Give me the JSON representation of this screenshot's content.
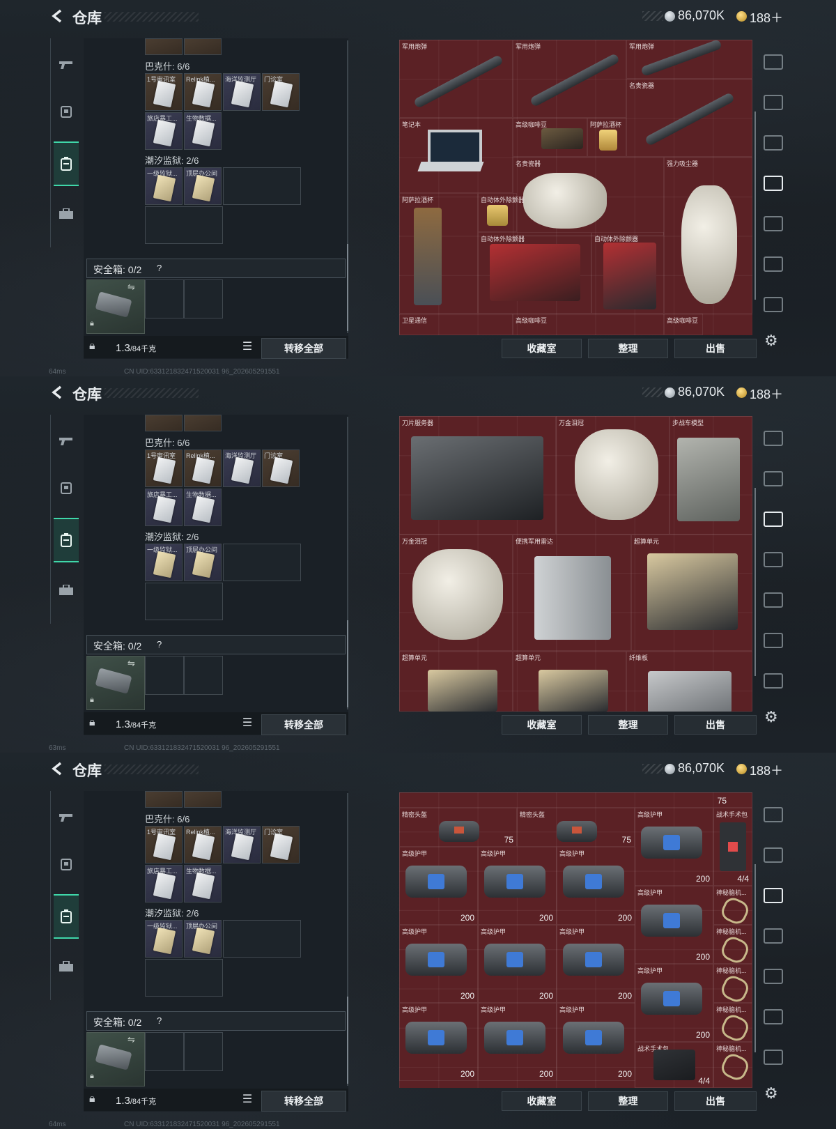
{
  "header": {
    "title": "仓库",
    "money": "86,070K",
    "gold": "188＋"
  },
  "sidebar_left": {
    "tabs": [
      "gun-icon",
      "armor-icon",
      "backpack-icon",
      "toolbox-icon"
    ],
    "active_index": 2
  },
  "inventory": {
    "section1_label": "巴克什: 6/6",
    "section1_items": [
      "1号审讯室",
      "Relink植...",
      "海洋监测厅",
      "门诊室",
      "旅店暴工...",
      "生物数据..."
    ],
    "section2_label": "潮汐监狱: 2/6",
    "section2_items": [
      "一级监狱...",
      "顶层办公间"
    ],
    "safe_label": "安全箱: 0/2",
    "safe_help": "?",
    "weight": "1.3",
    "weight_unit": "/84千克",
    "transfer_all": "转移全部"
  },
  "bottom_buttons": {
    "collection": "收藏室",
    "sort": "整理",
    "sell": "出售"
  },
  "status": {
    "ping1": "64ms",
    "ping2": "63ms",
    "ping3": "64ms",
    "uid": "CN UID:633121832471520031 96_202605291551"
  },
  "panels": [
    {
      "items": [
        {
          "name": "军用炮弹"
        },
        {
          "name": "军用炮弹"
        },
        {
          "name": "军用炮弹"
        },
        {
          "name": "笔记本"
        },
        {
          "name": "高级咖啡豆"
        },
        {
          "name": "阿萨拉酒杯"
        },
        {
          "name": "名贵瓷器"
        },
        {
          "name": "名贵瓷器"
        },
        {
          "name": "强力吸尘器"
        },
        {
          "name": "阿萨拉酒杯"
        },
        {
          "name": "自动体外除颤器"
        },
        {
          "name": "自动体外除颤器"
        },
        {
          "name": "自动体外除颤器"
        },
        {
          "name": "卫星通信"
        },
        {
          "name": "高级咖啡豆"
        },
        {
          "name": "高级咖啡豆"
        }
      ]
    },
    {
      "items": [
        {
          "name": "刀片服务器"
        },
        {
          "name": "万金泪冠"
        },
        {
          "name": "步战车模型"
        },
        {
          "name": "万金泪冠"
        },
        {
          "name": "便携军用雷达"
        },
        {
          "name": "超算单元"
        },
        {
          "name": "超算单元"
        },
        {
          "name": "超算单元"
        },
        {
          "name": "纤维板"
        }
      ]
    },
    {
      "items": [
        {
          "name": "精密头盔",
          "val": "75"
        },
        {
          "name": "精密头盔",
          "val": "75"
        },
        {
          "name": "高级护甲",
          "val": "200"
        },
        {
          "name": "战术手术包",
          "val": "4/4"
        },
        {
          "name": "高级护甲",
          "val": "200"
        },
        {
          "name": "高级护甲",
          "val": "200"
        },
        {
          "name": "高级护甲",
          "val": "200"
        },
        {
          "name": "高级护甲",
          "val": "200"
        },
        {
          "name": "神秘脑机...",
          "val": ""
        },
        {
          "name": "高级护甲",
          "val": "200"
        },
        {
          "name": "高级护甲",
          "val": "200"
        },
        {
          "name": "高级护甲",
          "val": "200"
        },
        {
          "name": "高级护甲",
          "val": "200"
        },
        {
          "name": "神秘脑机...",
          "val": ""
        },
        {
          "name": "高级护甲",
          "val": "200"
        },
        {
          "name": "高级护甲",
          "val": "200"
        },
        {
          "name": "高级护甲",
          "val": "200"
        },
        {
          "name": "战术手术包",
          "val": "4/4"
        },
        {
          "name": "神秘脑机...",
          "val": ""
        },
        {
          "name": "top-partial",
          "val": "75"
        }
      ]
    }
  ],
  "colors": {
    "accent": "#3fd7a9",
    "grid_bg": "#5b2125",
    "panel_bg": "#1a2026"
  }
}
